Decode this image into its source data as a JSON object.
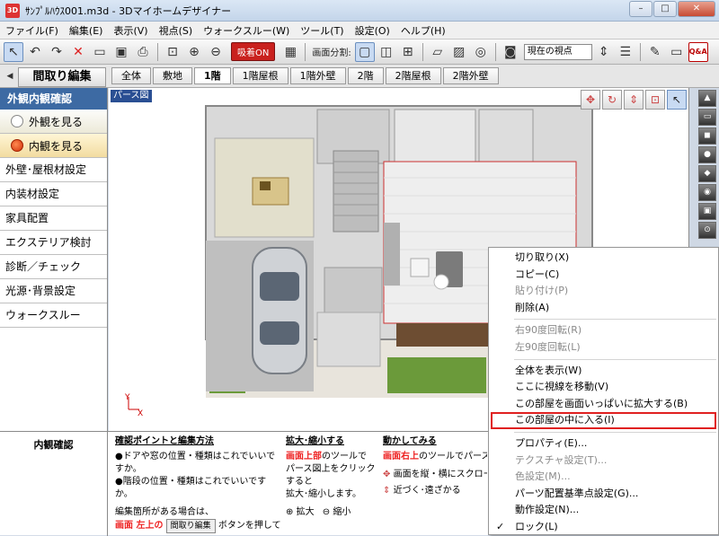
{
  "window": {
    "title": "ｻﾝﾌﾟﾙﾊｳｽ001.m3d - 3Dマイホームデザイナー",
    "app_icon": "3D",
    "controls": [
      "–",
      "□",
      "✕"
    ]
  },
  "menubar": [
    "ファイル(F)",
    "編集(E)",
    "表示(V)",
    "視点(S)",
    "ウォークスルー(W)",
    "ツール(T)",
    "設定(O)",
    "ヘルプ(H)"
  ],
  "toolbar": {
    "adsorb_label": "吸着ON",
    "split_label": "画面分割:",
    "viewpoint_select": "現在の視点",
    "qa_label": "Q&A"
  },
  "tabbar": {
    "edit_button": "間取り編集",
    "collapse": "◀",
    "floor_tabs": [
      "全体",
      "敷地",
      "1階",
      "1階屋根",
      "1階外壁",
      "2階",
      "2階屋根",
      "2階外壁"
    ],
    "active_tab": "1階"
  },
  "leftpanel": {
    "header": "外観内観確認",
    "radios": [
      {
        "label": "外観を見る",
        "on": false
      },
      {
        "label": "内観を見る",
        "on": true
      }
    ],
    "items": [
      "外壁･屋根材設定",
      "内装材設定",
      "家具配置",
      "エクステリア検討",
      "診断／チェック",
      "光源･背景設定",
      "ウォークスルー"
    ]
  },
  "viewport": {
    "label": "パース図",
    "axis_y": "Y",
    "axis_x": "X",
    "tools": [
      "✥",
      "↻",
      "⇕",
      "⊡",
      "↖"
    ]
  },
  "rightstrip": [
    "▲",
    "▭",
    "◼",
    "●",
    "◆",
    "◉",
    "▣",
    "⊙"
  ],
  "bottom": {
    "title": "内観確認",
    "col1": {
      "heading": "確認ポイントと編集方法",
      "lines": [
        "●ドアや窓の位置・種類はこれでいいですか。",
        "●階段の位置・種類はこれでいいですか。",
        "",
        "編集箇所がある場合は、"
      ],
      "red_text": "画面 左上の",
      "button": "間取り編集",
      "tail": "ボタンを押して"
    },
    "col2": {
      "heading": "拡大･縮小する",
      "red_text": "画面上部",
      "lines": [
        "のツールで",
        "パース図上をクリックすると",
        "拡大･縮小します。"
      ],
      "zoom_in": "拡大",
      "zoom_out": "縮小"
    },
    "col3": {
      "heading": "動かしてみる",
      "red_text": "画面右上",
      "line1": "のツールでパース図",
      "line2": "画面を縦・横にスクロー",
      "line3": "近づく･遠ざかる"
    }
  },
  "context_menu": {
    "groups": [
      [
        {
          "label": "切り取り(X)",
          "disabled": false
        },
        {
          "label": "コピー(C)",
          "disabled": false
        },
        {
          "label": "貼り付け(P)",
          "disabled": true
        },
        {
          "label": "削除(A)",
          "disabled": false
        }
      ],
      [
        {
          "label": "右90度回転(R)",
          "disabled": true
        },
        {
          "label": "左90度回転(L)",
          "disabled": true
        }
      ],
      [
        {
          "label": "全体を表示(W)",
          "disabled": false
        },
        {
          "label": "ここに視線を移動(V)",
          "disabled": false
        },
        {
          "label": "この部屋を画面いっぱいに拡大する(B)",
          "disabled": false
        },
        {
          "label": "この部屋の中に入る(I)",
          "disabled": false,
          "highlight": true
        }
      ],
      [
        {
          "label": "プロパティ(E)...",
          "disabled": false
        },
        {
          "label": "テクスチャ設定(T)...",
          "disabled": true
        },
        {
          "label": "色設定(M)...",
          "disabled": true
        },
        {
          "label": "パーツ配置基準点設定(G)...",
          "disabled": false
        },
        {
          "label": "動作設定(N)...",
          "disabled": false
        },
        {
          "label": "ロック(L)",
          "disabled": false,
          "checked": true
        }
      ]
    ],
    "check_mark": "✓"
  }
}
